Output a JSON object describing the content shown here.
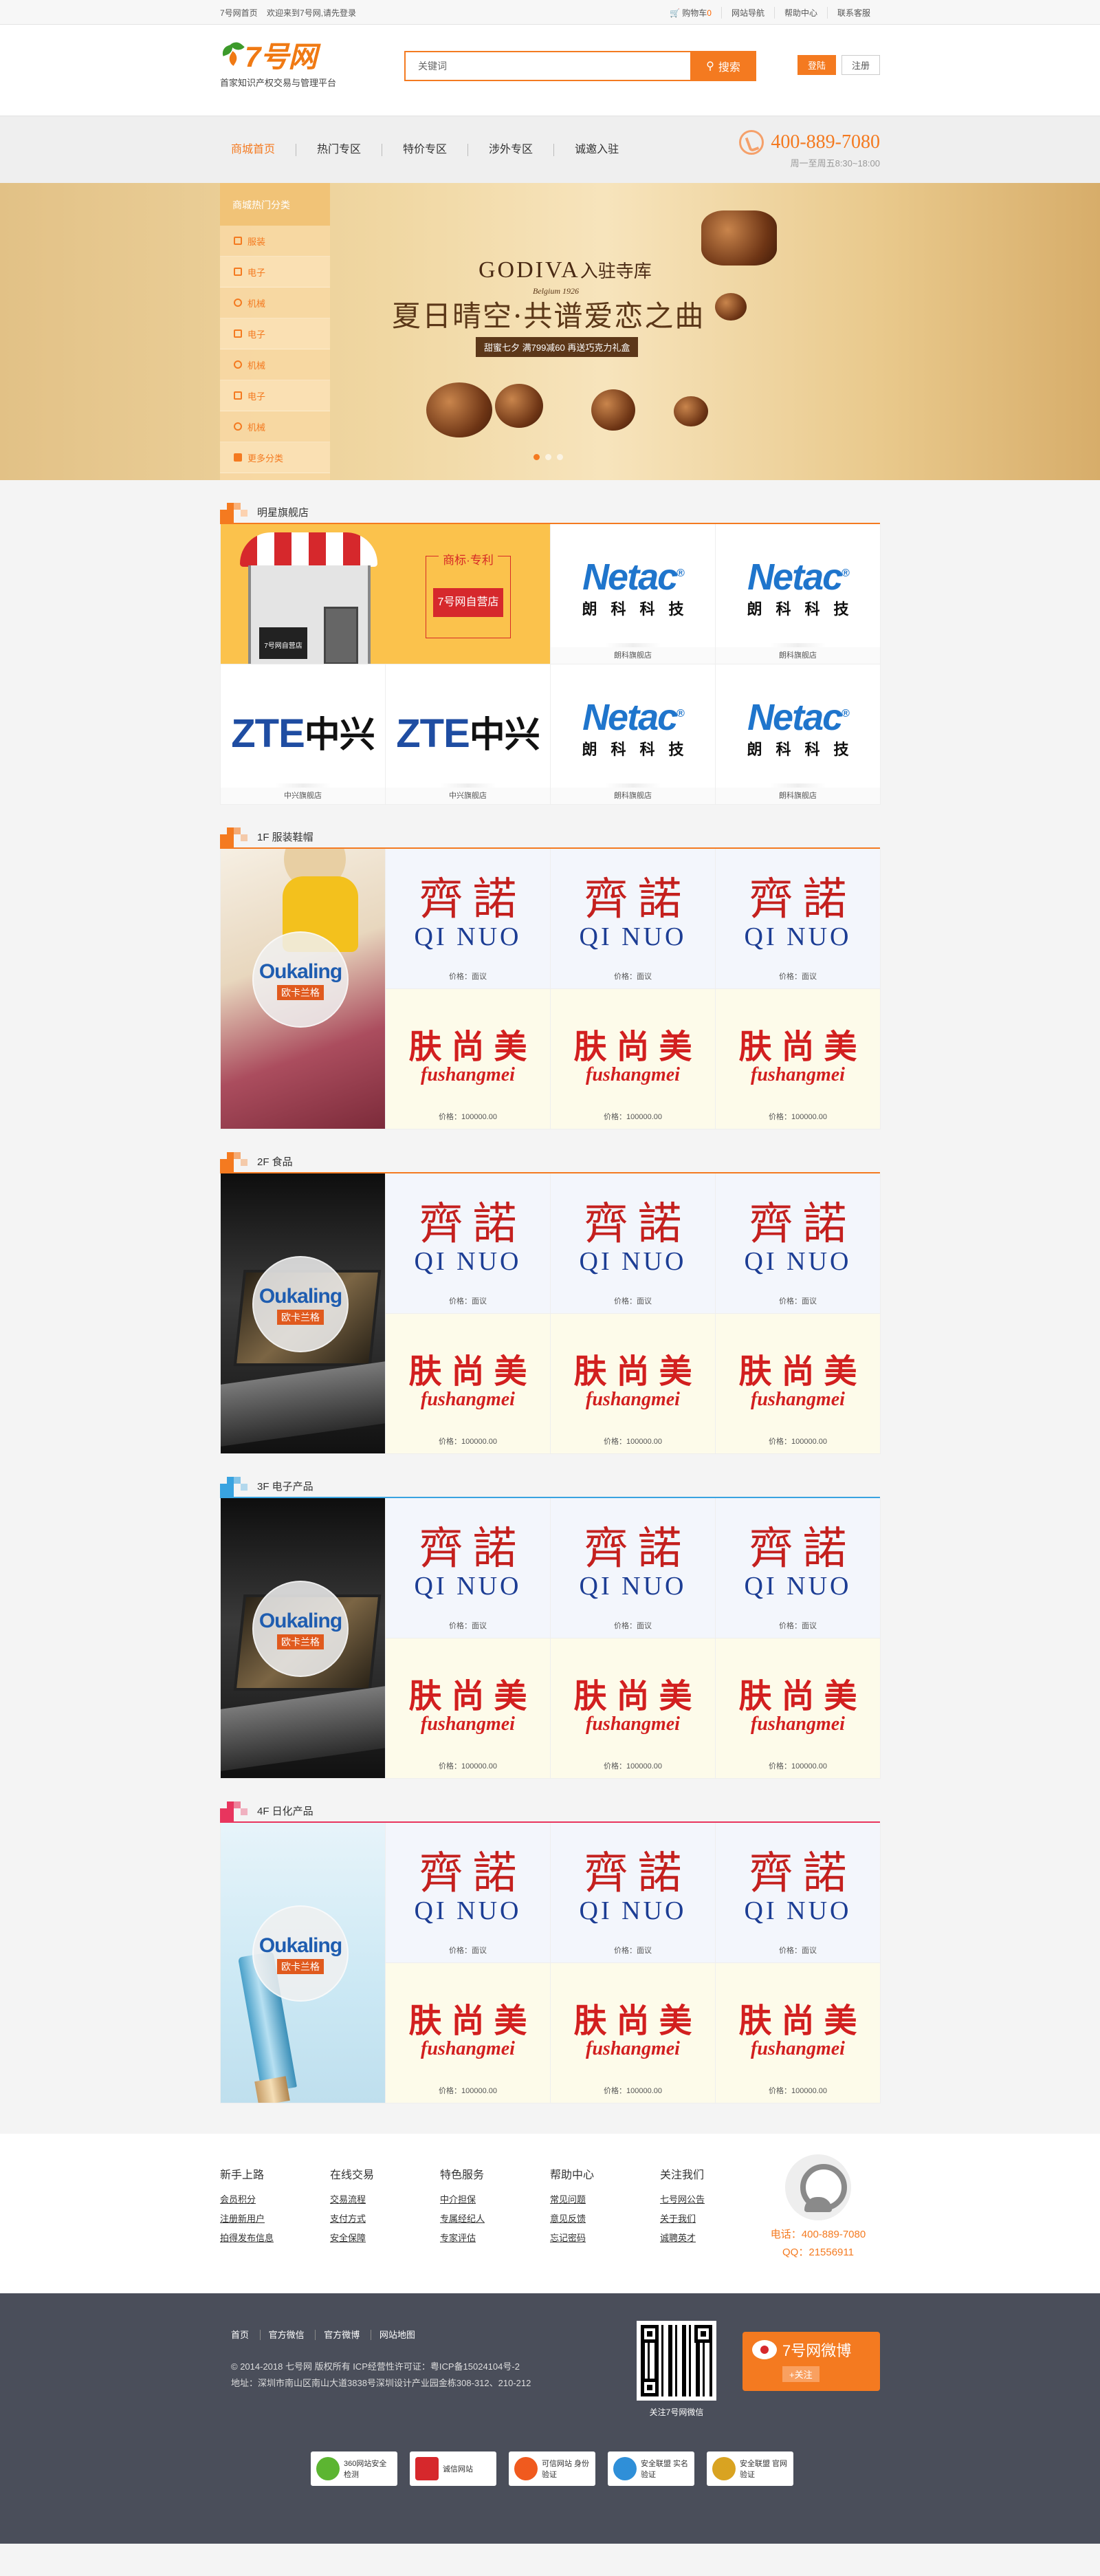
{
  "topbar": {
    "home": "7号网首页",
    "welcome": "欢迎来到7号网,请先登录",
    "cart": "购物车",
    "cart_count": "0",
    "site_nav": "网站导航",
    "help": "帮助中心",
    "contact": "联系客服"
  },
  "header": {
    "logo_text": "7号网",
    "slogan": "首家知识产权交易与管理平台",
    "search_placeholder": "关键词",
    "search_button": "搜索",
    "login": "登陆",
    "register": "注册"
  },
  "nav": {
    "items": [
      "商城首页",
      "热门专区",
      "特价专区",
      "涉外专区",
      "诚邀入驻"
    ],
    "phone": "400-889-7080",
    "hours": "周一至周五8:30~18:00"
  },
  "banner": {
    "category_title": "商城热门分类",
    "categories": [
      "服装",
      "电子",
      "机械",
      "电子",
      "机械",
      "电子",
      "机械",
      "更多分类"
    ],
    "brand": "GODIVA",
    "brand_suffix": "入驻寺库",
    "brand_origin": "Belgium 1926",
    "headline": "夏日晴空·共谱爱恋之曲",
    "promo": "甜蜜七夕 满799减60 再送巧克力礼盒"
  },
  "sections": {
    "flagship": {
      "title": "明星旗舰店",
      "self_tag": "商标·专利",
      "self_button": "7号网自营店",
      "self_sign": "7号网自营店",
      "netac_en": "Netac",
      "netac_reg": "®",
      "netac_cn": "朗科科技",
      "netac_store": "朗科旗舰店",
      "zte_en": "ZTE",
      "zte_cn": "中兴",
      "zte_store": "中兴旗舰店"
    },
    "floor1": {
      "title": "1F 服装鞋帽"
    },
    "floor2": {
      "title": "2F 食品"
    },
    "floor3": {
      "title": "3F 电子产品"
    },
    "floor4": {
      "title": "4F 日化产品"
    },
    "badge_en": "Oukaling",
    "badge_cn": "欧卡兰格",
    "qinuo_cn": "齊諾",
    "qinuo_en": "QI NUO",
    "qinuo_price": "价格：面议",
    "fushang_cn": "肤尚美",
    "fushang_en": "fushangmei",
    "fushang_price": "价格：100000.00"
  },
  "footer_links": {
    "cols": [
      {
        "title": "新手上路",
        "links": [
          "会员积分",
          "注册新用户",
          "拍得发布信息"
        ]
      },
      {
        "title": "在线交易",
        "links": [
          "交易流程",
          "支付方式",
          "安全保障"
        ]
      },
      {
        "title": "特色服务",
        "links": [
          "中介担保",
          "专属经纪人",
          "专家评估"
        ]
      },
      {
        "title": "帮助中心",
        "links": [
          "常见问题",
          "意见反馈",
          "忘记密码"
        ]
      },
      {
        "title": "关注我们",
        "links": [
          "七号网公告",
          "关于我们",
          "诚聘英才"
        ]
      }
    ],
    "service_phone": "电话：400-889-7080",
    "service_qq": "QQ：21556911"
  },
  "footer": {
    "nav": [
      "首页",
      "官方微信",
      "官方微博",
      "网站地图"
    ],
    "copyright": "© 2014-2018 七号网 版权所有 ICP经营性许可证：粤ICP备15024104号-2",
    "address": "地址：深圳市南山区南山大道3838号深圳设计产业园金栋308-312、210-212",
    "qr_caption": "关注7号网微信",
    "weibo_title": "7号网微博",
    "weibo_follow": "+关注",
    "certs": [
      "360网站安全检测",
      "诚信网站",
      "可信网站 身份验证",
      "安全联盟 实名验证",
      "安全联盟 官网验证"
    ]
  },
  "colors": {
    "accent": "#f47a20",
    "footer_bg": "#4a4e5a"
  }
}
